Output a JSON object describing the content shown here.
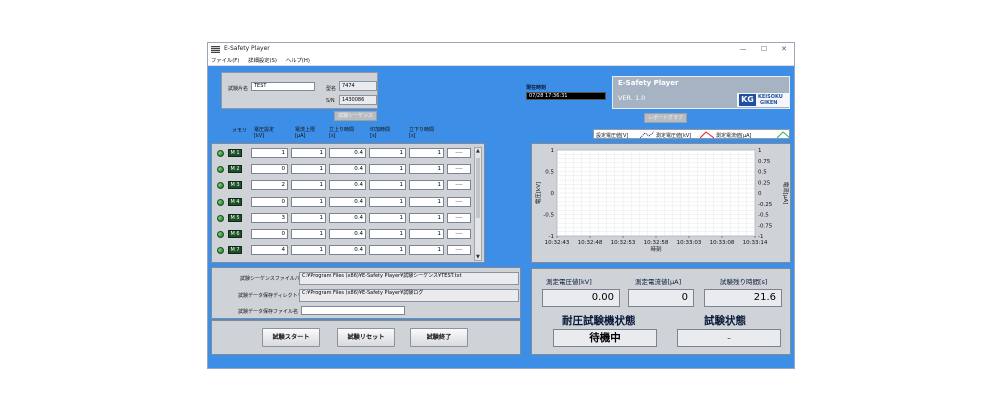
{
  "window": {
    "title": "E-Safety Player",
    "min": "—",
    "max": "☐",
    "close": "✕"
  },
  "menu": [
    "ファイル(F)",
    "詳細設定(S)",
    "ヘルプ(H)"
  ],
  "header": {
    "test_name_label": "試験片名",
    "test_name_value": "TEST",
    "model_label": "型名",
    "model_value": "7474",
    "sn_label": "S/N",
    "sn_value": "1430086",
    "sequence_button": "試験シーケンス",
    "time_label": "現在時刻",
    "time_value": "07/28 17:36:31",
    "report_button": "レポートグラフ"
  },
  "brand": {
    "name": "E-Safety Player",
    "version": "VER. 1.0",
    "logo": "KG",
    "logo_text_1": "KEISOKU",
    "logo_text_2": "GIKEN"
  },
  "table": {
    "headers": [
      "メモリ",
      "電圧設定\n[kV]",
      "電流上限\n[μA]",
      "立上り時間\n[s]",
      "印加時間\n[s]",
      "立下り時間\n[s]"
    ],
    "rows": [
      {
        "mem": "M 1",
        "v": "1",
        "i": "1",
        "rise": "0.4",
        "apply": "1",
        "fall": "1",
        "extra": "----"
      },
      {
        "mem": "M 2",
        "v": "0",
        "i": "1",
        "rise": "0.4",
        "apply": "1",
        "fall": "1",
        "extra": "----"
      },
      {
        "mem": "M 3",
        "v": "2",
        "i": "1",
        "rise": "0.4",
        "apply": "1",
        "fall": "1",
        "extra": "----"
      },
      {
        "mem": "M 4",
        "v": "0",
        "i": "1",
        "rise": "0.4",
        "apply": "1",
        "fall": "1",
        "extra": "----"
      },
      {
        "mem": "M 5",
        "v": "3",
        "i": "1",
        "rise": "0.4",
        "apply": "1",
        "fall": "1",
        "extra": "----"
      },
      {
        "mem": "M 6",
        "v": "0",
        "i": "1",
        "rise": "0.4",
        "apply": "1",
        "fall": "1",
        "extra": "----"
      },
      {
        "mem": "M 7",
        "v": "4",
        "i": "1",
        "rise": "0.4",
        "apply": "1",
        "fall": "1",
        "extra": "----"
      }
    ]
  },
  "paths": {
    "seq_label": "試験シーケンスファイルパス",
    "seq_value": "C:¥Program Files (x86)¥E-Safety Player¥試験シーケンス¥TEST.txt",
    "dir_label": "試験データ保存ディレクトリ",
    "dir_value": "C:¥Program Files (x86)¥E-Safety Player¥試験ログ",
    "file_label": "試験データ保存ファイル名",
    "file_value": ""
  },
  "buttons": {
    "start": "試験スタート",
    "reset": "試験リセット",
    "end": "試験終了"
  },
  "legend": {
    "set_voltage": "設定電圧値[V]",
    "meas_voltage": "測定電圧値[kV]",
    "meas_current": "測定電流値[μA]"
  },
  "chart_data": {
    "type": "line",
    "xlabel": "時刻",
    "ylabel": "電圧[kV]",
    "y2label": "電流[μA]",
    "x_ticks": [
      "10:32:43",
      "10:32:48",
      "10:32:53",
      "10:32:58",
      "10:33:03",
      "10:33:08",
      "10:33:14"
    ],
    "y_ticks": [
      "1",
      "0.5",
      "0",
      "-0.5",
      "-1"
    ],
    "y2_ticks": [
      "1",
      "0.75",
      "0.5",
      "0.25",
      "0",
      "-0.25",
      "-0.5",
      "-0.75",
      "-1"
    ],
    "ylim": [
      -1,
      1
    ],
    "y2lim": [
      -1,
      1
    ],
    "grid": true,
    "series": []
  },
  "status": {
    "meas_v_label": "測定電圧値[kV]",
    "meas_v_value": "0.00",
    "meas_i_label": "測定電流値[μA]",
    "meas_i_value": "0",
    "remain_label": "試験残り時間[s]",
    "remain_value": "21.6",
    "machine_label": "耐圧試験機状態",
    "machine_value": "待機中",
    "test_label": "試験状態",
    "test_value": "–"
  },
  "colors": {
    "panel_blue": "#3d8ee6",
    "meas_voltage": "#0b1f6e",
    "meas_current": "#d42020",
    "set_voltage": "#22b14c"
  }
}
